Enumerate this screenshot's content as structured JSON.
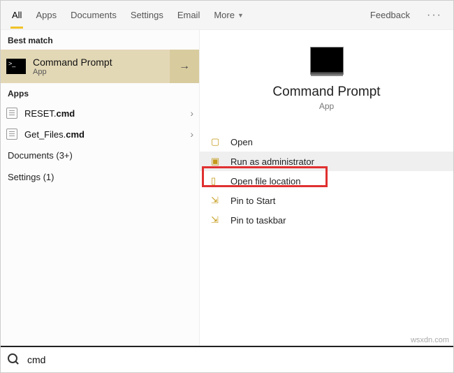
{
  "tabs": {
    "all": "All",
    "apps": "Apps",
    "documents": "Documents",
    "settings": "Settings",
    "email": "Email",
    "more": "More",
    "feedback": "Feedback"
  },
  "left": {
    "best_match_header": "Best match",
    "best_match": {
      "title": "Command Prompt",
      "sub": "App"
    },
    "apps_header": "Apps",
    "apps": [
      {
        "name": "RESET.cmd"
      },
      {
        "name": "Get_Files.cmd"
      }
    ],
    "documents_header": "Documents (3+)",
    "settings_header": "Settings (1)"
  },
  "right": {
    "title": "Command Prompt",
    "sub": "App",
    "actions": {
      "open": "Open",
      "runadmin": "Run as administrator",
      "openloc": "Open file location",
      "pinstart": "Pin to Start",
      "pintaskbar": "Pin to taskbar"
    }
  },
  "search": {
    "value": "cmd"
  },
  "watermark": "wsxdn.com"
}
